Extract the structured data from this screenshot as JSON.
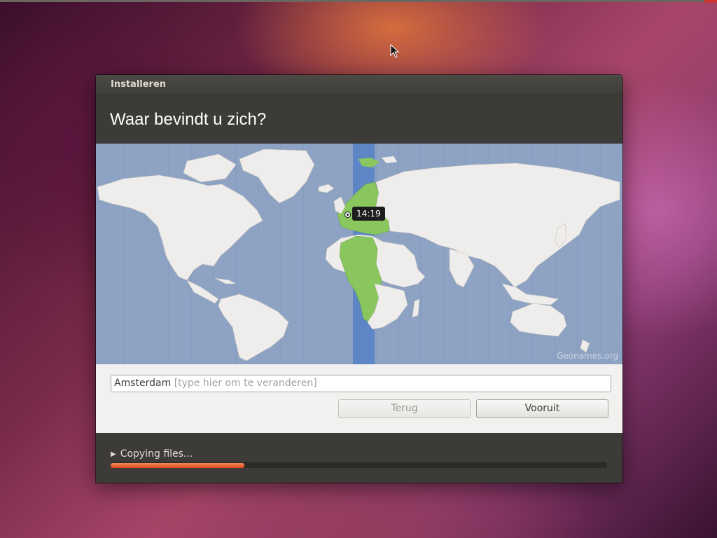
{
  "window": {
    "title": "Installeren"
  },
  "page": {
    "heading": "Waar bevindt u zich?"
  },
  "map": {
    "time_label": "14:19",
    "attribution": "Geonames.org"
  },
  "location": {
    "value": "Amsterdam",
    "placeholder": "[type hier om te veranderen]"
  },
  "buttons": {
    "back_label": "Terug",
    "forward_label": "Vooruit"
  },
  "progress": {
    "label": "Copying files...",
    "fraction": 0.27
  },
  "colors": {
    "ocean": "#8ea3c4",
    "land": "#efedeb",
    "timezone_land": "#89c65e",
    "timezone_band": "#5d86c7",
    "progress": "#dd4814"
  }
}
